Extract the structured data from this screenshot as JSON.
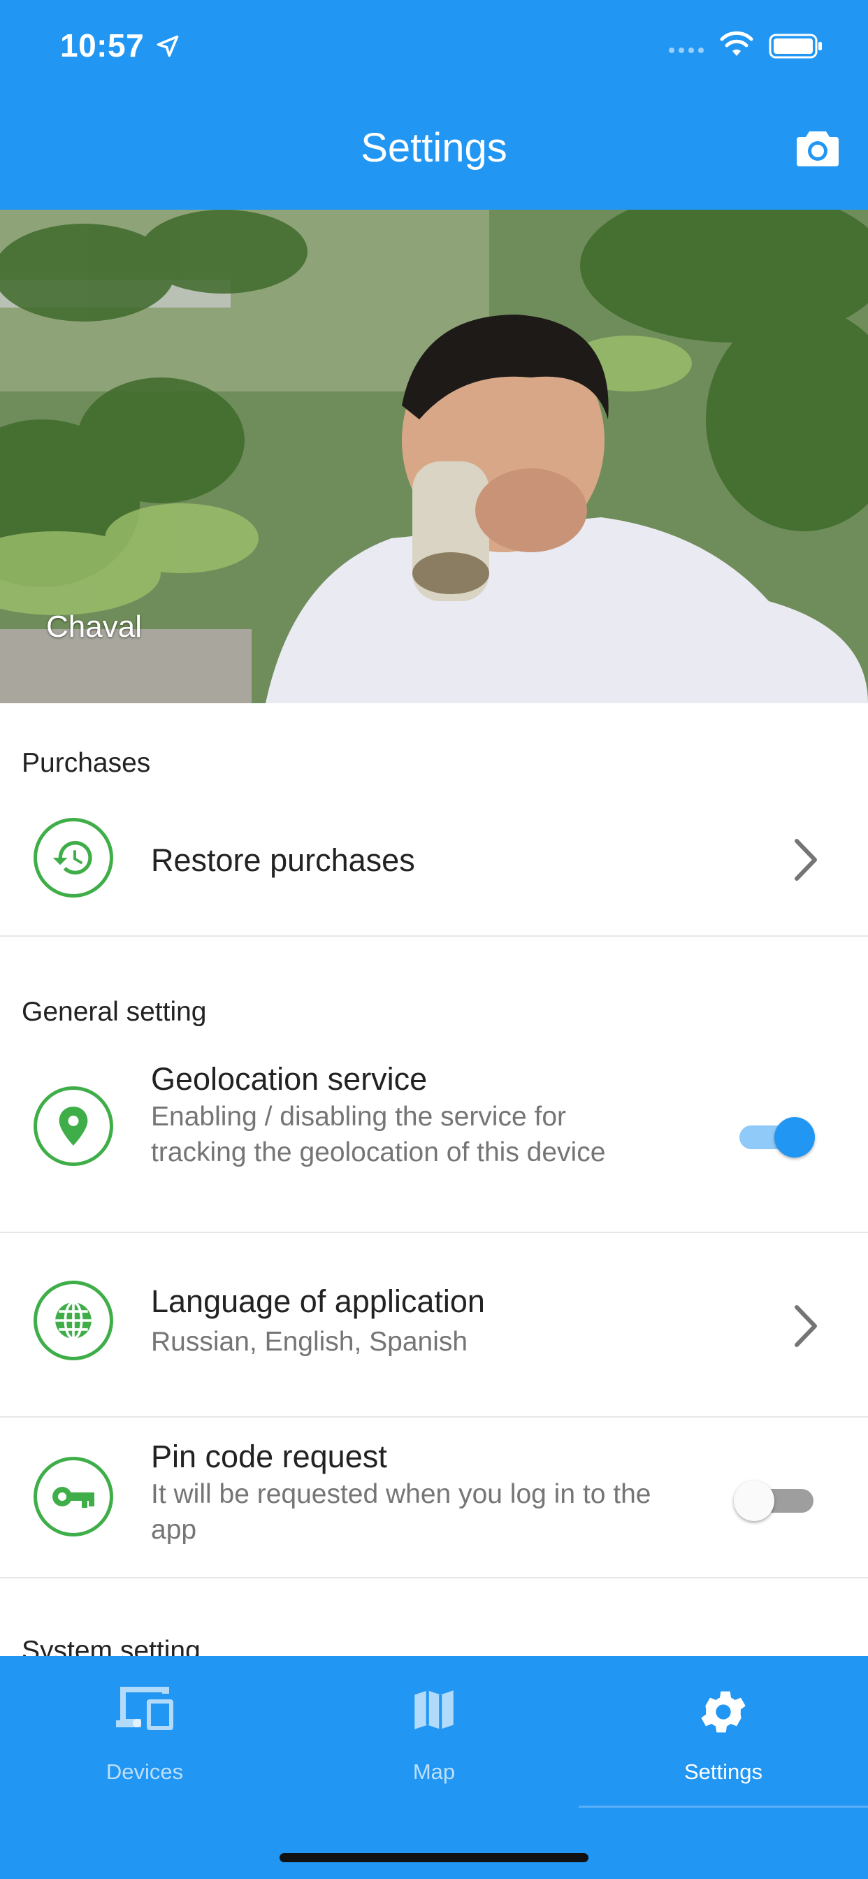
{
  "status_bar": {
    "time": "10:57"
  },
  "header": {
    "title": "Settings"
  },
  "photo": {
    "caption": "Chaval"
  },
  "sections": {
    "purchases": {
      "title": "Purchases",
      "restore": {
        "title": "Restore purchases"
      }
    },
    "general": {
      "title": "General setting",
      "geolocation": {
        "title": "Geolocation service",
        "subtitle": "Enabling / disabling the service for tracking the geolocation of this device",
        "enabled": true
      },
      "language": {
        "title": "Language of application",
        "subtitle": "Russian, English, Spanish"
      },
      "pin": {
        "title": "Pin code request",
        "subtitle": "It will be requested when you log in to the app",
        "enabled": false
      }
    },
    "system": {
      "title": "System setting"
    }
  },
  "tabbar": {
    "tabs": [
      {
        "label": "Devices",
        "icon": "devices-icon",
        "active": false
      },
      {
        "label": "Map",
        "icon": "map-icon",
        "active": false
      },
      {
        "label": "Settings",
        "icon": "gear-icon",
        "active": true
      }
    ]
  },
  "colors": {
    "primary": "#2196F3",
    "accent_green": "#3fae49",
    "toggle_on_knob": "#2196F3",
    "toggle_on_track": "#90caf9",
    "toggle_off_knob": "#fafafa",
    "toggle_off_track": "#9e9e9e"
  }
}
